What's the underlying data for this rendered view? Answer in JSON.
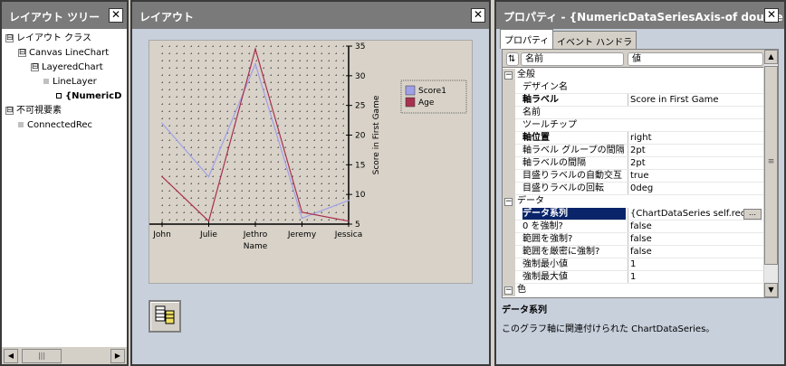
{
  "layout_tree": {
    "title": "レイアウト ツリー",
    "close_glyph": "✕",
    "items": [
      {
        "expander": "⊟",
        "label": "レイアウト クラス",
        "bold": false
      },
      {
        "expander": "⊟",
        "label": "Canvas LineChart",
        "bold": false
      },
      {
        "expander": "⊟",
        "label": "LayeredChart",
        "bold": false
      },
      {
        "expander": "",
        "label": "LineLayer",
        "bold": false
      },
      {
        "expander": "",
        "label": "{NumericD",
        "bold": true
      },
      {
        "expander": "⊟",
        "label": "不可視要素",
        "bold": false
      },
      {
        "expander": "",
        "label": "ConnectedRec",
        "bold": false
      }
    ],
    "scroll_left": "◀",
    "scroll_right": "▶",
    "thumb_grip": "|||"
  },
  "layout": {
    "title": "レイアウト",
    "close_glyph": "✕"
  },
  "chart_data": {
    "type": "line",
    "categories": [
      "John",
      "Julie",
      "Jethro",
      "Jeremy",
      "Jessica"
    ],
    "xlabel": "Name",
    "ylabel": "Score in First Game",
    "ylim": [
      5,
      35
    ],
    "yticks": [
      5,
      10,
      15,
      20,
      25,
      30,
      35
    ],
    "y_axis_position": "right",
    "grid": "dotted",
    "legend_placement": "right",
    "series": [
      {
        "name": "Score1",
        "color": "#9fa0e8",
        "values": [
          22,
          13,
          32,
          6,
          9
        ]
      },
      {
        "name": "Age",
        "color": "#a83050",
        "values": [
          13,
          5.5,
          34.5,
          7,
          5.5
        ]
      }
    ]
  },
  "properties": {
    "title": "プロパティ - {NumericDataSeriesAxis-of double",
    "close_glyph": "✕",
    "tabs": [
      "プロパティ",
      "イベント ハンドラ"
    ],
    "sort_glyph": "⇅",
    "col_name": "名前",
    "col_value": "値",
    "ellipsis": "…",
    "scroll_up": "▲",
    "scroll_down": "▼",
    "thumb_grip": "≡",
    "rows": [
      {
        "kind": "cat",
        "name": "全般",
        "value": ""
      },
      {
        "kind": "prop",
        "name": "デザイン名",
        "value": "",
        "bold": false
      },
      {
        "kind": "prop",
        "name": "軸ラベル",
        "value": "Score in First Game",
        "bold": true
      },
      {
        "kind": "prop",
        "name": "名前",
        "value": "",
        "bold": false
      },
      {
        "kind": "prop",
        "name": "ツールチップ",
        "value": "",
        "bold": false
      },
      {
        "kind": "prop",
        "name": "軸位置",
        "value": "right",
        "bold": true
      },
      {
        "kind": "prop",
        "name": "軸ラベル グループの間隔",
        "value": "2pt",
        "bold": false
      },
      {
        "kind": "prop",
        "name": "軸ラベルの間隔",
        "value": "2pt",
        "bold": false
      },
      {
        "kind": "prop",
        "name": "目盛りラベルの自動交互",
        "value": "true",
        "bold": false
      },
      {
        "kind": "prop",
        "name": "目盛りラベルの回転",
        "value": "0deg",
        "bold": false
      },
      {
        "kind": "cat",
        "name": "データ",
        "value": ""
      },
      {
        "kind": "sel",
        "name": "データ系列",
        "value": "{ChartDataSeries self.rec",
        "bold": true
      },
      {
        "kind": "prop",
        "name": "0 を強制?",
        "value": "false",
        "bold": false
      },
      {
        "kind": "prop",
        "name": "範囲を強制?",
        "value": "false",
        "bold": false
      },
      {
        "kind": "prop",
        "name": "範囲を厳密に強制?",
        "value": "false",
        "bold": false
      },
      {
        "kind": "prop",
        "name": "強制最小値",
        "value": "1",
        "bold": false
      },
      {
        "kind": "prop",
        "name": "強制最大値",
        "value": "1",
        "bold": false
      },
      {
        "kind": "cat",
        "name": "色",
        "value": ""
      }
    ],
    "description": {
      "title": "データ系列",
      "text": "このグラフ軸に関連付けられた ChartDataSeries。"
    }
  }
}
